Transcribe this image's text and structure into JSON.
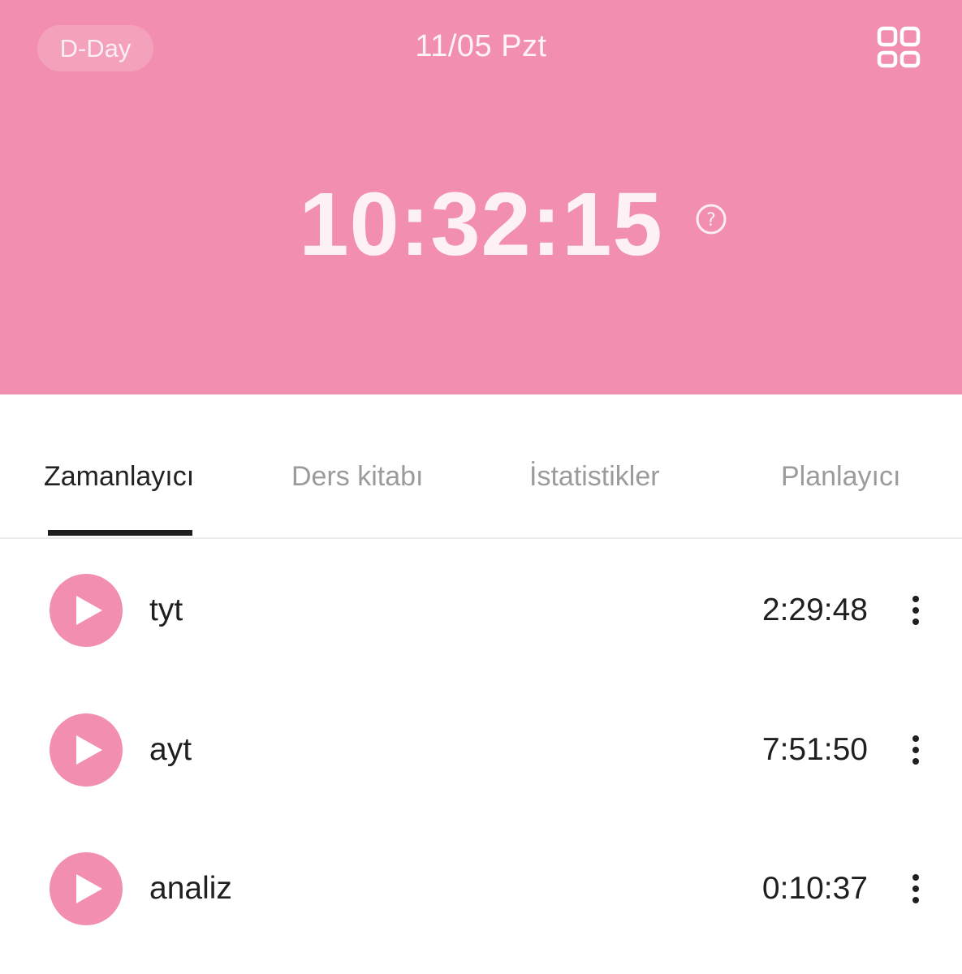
{
  "header": {
    "dday_label": "D-Day",
    "date_label": "11/05 Pzt",
    "timer": "10:32:15",
    "grid_icon": "grid-icon",
    "help_icon": "help-icon",
    "background_color": "#f28fb0"
  },
  "tabs": [
    {
      "label": "Zamanlayıcı",
      "active": true
    },
    {
      "label": "Ders kitabı",
      "active": false
    },
    {
      "label": "İstatistikler",
      "active": false
    },
    {
      "label": "Planlayıcı",
      "active": false
    }
  ],
  "subjects": [
    {
      "name": "tyt",
      "time": "2:29:48"
    },
    {
      "name": "ayt",
      "time": "7:51:50"
    },
    {
      "name": "analiz",
      "time": "0:10:37"
    }
  ],
  "colors": {
    "accent": "#f28fb0",
    "text": "#1f1f1f",
    "inactive_tab": "#9b9b9b"
  }
}
